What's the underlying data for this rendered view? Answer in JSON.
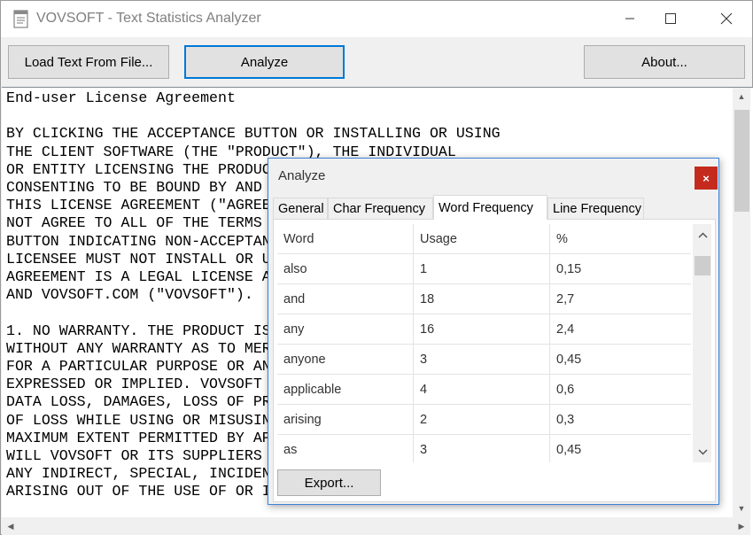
{
  "window": {
    "title": "VOVSOFT - Text Statistics Analyzer",
    "icon": "document-icon"
  },
  "toolbar": {
    "load_label": "Load Text From File...",
    "analyze_label": "Analyze",
    "about_label": "About..."
  },
  "editor": {
    "text": "End-user License Agreement\n\nBY CLICKING THE ACCEPTANCE BUTTON OR INSTALLING OR USING\nTHE CLIENT SOFTWARE (THE \"PRODUCT\"), THE INDIVIDUAL\nOR ENTITY LICENSING THE PRODUCT (\"LICENSEE\") IS\nCONSENTING TO BE BOUND BY AND IS BECOMING A PARTY TO\nTHIS LICENSE AGREEMENT (\"AGREEMENT\"). IF LICENSEE DOES\nNOT AGREE TO ALL OF THE TERMS OF THIS AGREEMENT, THE\nBUTTON INDICATING NON-ACCEPTANCE MUST BE SELECTED, AND\nLICENSEE MUST NOT INSTALL OR USE THE SOFTWARE. THIS\nAGREEMENT IS A LEGAL LICENSE AGREEMENT BETWEEN LICENSEE\nAND VOVSOFT.COM (\"VOVSOFT\").\n\n1. NO WARRANTY. THE PRODUCT IS PROVIDED \"AS IS\"\nWITHOUT ANY WARRANTY AS TO MERCHANTABILITY OR FITNESS\nFOR A PARTICULAR PURPOSE OR ANY OTHER WARRANTY,\nEXPRESSED OR IMPLIED. VOVSOFT IS NOT RESPONSIBLE FOR\nDATA LOSS, DAMAGES, LOSS OF PROFITS OR ANY OTHER KIND\nOF LOSS WHILE USING OR MISUSING THIS SOFTWARE. TO THE\nMAXIMUM EXTENT PERMITTED BY APPLICABLE LAW, IN NO EVENT\nWILL VOVSOFT OR ITS SUPPLIERS BE LIABLE TO YOU FOR\nANY INDIRECT, SPECIAL, INCIDENTAL OR CONSEQUENTIAL\nARISING OUT OF THE USE OF OR INABILITY TO USE"
  },
  "dialog": {
    "title": "Analyze",
    "close_label": "×",
    "tabs": [
      {
        "label": "General"
      },
      {
        "label": "Char Frequency"
      },
      {
        "label": "Word Frequency"
      },
      {
        "label": "Line Frequency"
      }
    ],
    "active_tab": "Word Frequency",
    "columns": [
      "Word",
      "Usage",
      "%"
    ],
    "rows": [
      [
        "also",
        "1",
        "0,15"
      ],
      [
        "and",
        "18",
        "2,7"
      ],
      [
        "any",
        "16",
        "2,4"
      ],
      [
        "anyone",
        "3",
        "0,45"
      ],
      [
        "applicable",
        "4",
        "0,6"
      ],
      [
        "arising",
        "2",
        "0,3"
      ],
      [
        "as",
        "3",
        "0,45"
      ]
    ],
    "export_label": "Export..."
  }
}
